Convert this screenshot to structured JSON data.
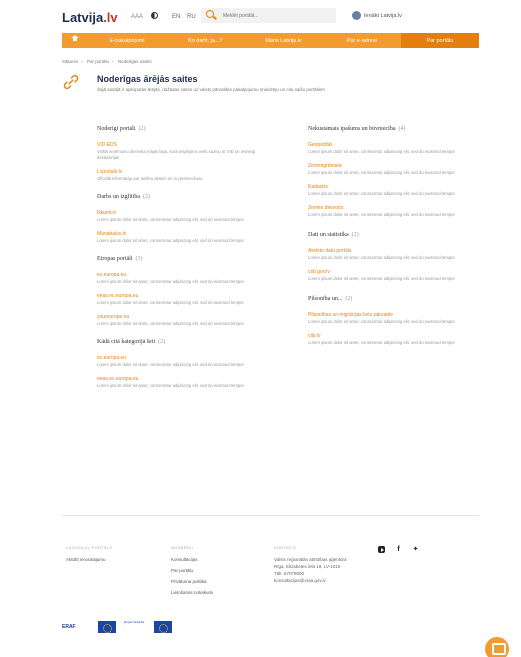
{
  "header": {
    "logo_text": "Latvija",
    "logo_accent": ".lv",
    "text_size_label": "AAA",
    "languages": [
      "EN",
      "RU"
    ],
    "search_placeholder": "Meklēt portālā...",
    "login_label": "Ienākt Latvija.lv"
  },
  "nav": {
    "items": [
      "E-pakalpojumi",
      "Ko darīt, ja...?",
      "Mans Latvija.lv",
      "Par e-adresi",
      "Par portālu"
    ],
    "active": "Par portālu"
  },
  "breadcrumb": [
    "Sākums",
    "Par portālu",
    "Noderīgas saites"
  ],
  "page": {
    "title": "Noderīgas ārējās saites",
    "description": "Šajā sadaļā ir apkopotas ārējās, dažādas saites uz valsts pārvaldes pakalpojumu sniedzēju un citu saišu portāliem",
    "icon": "link-icon"
  },
  "left_sections": [
    {
      "title": "Noderīgi portāli",
      "count": "(2)",
      "links": [
        {
          "title": "VID EDS",
          "desc": "Valsts ieņēmumu dienesta mājas lapa, kurā iespējams veikt saziņu ar VID un iesniegt deklarācijas"
        },
        {
          "title": "Lvportals.lv",
          "desc": "Oficiālā informācija par tiesību aktiem un to piemērošanu"
        }
      ]
    },
    {
      "title": "Darbs un izglītība",
      "count": "(2)",
      "links": [
        {
          "title": "Nkuml.lv",
          "desc": "Lorem ipsum dolor sit amet, consectetur adipiscing elit, sed do eiusmod tempor"
        },
        {
          "title": "Manabalss.lv",
          "desc": "Lorem ipsum dolor sit amet, consectetur adipiscing elit, sed do eiusmod tempor"
        }
      ]
    },
    {
      "title": "Eiropas portāli",
      "count": "(3)",
      "links": [
        {
          "title": "ec.europa.eu",
          "desc": "Lorem ipsum dolor sit amet, consectetur adipiscing elit, sed do eiusmod tempor"
        },
        {
          "title": "eeas.ec.europa.eu",
          "desc": "Lorem ipsum dolor sit amet, consectetur adipiscing elit, sed do eiusmod tempor"
        },
        {
          "title": "youreurope.eu",
          "desc": "Lorem ipsum dolor sit amet, consectetur adipiscing elit, sed do eiusmod tempor"
        }
      ]
    },
    {
      "title": "Kādā citā kategorijā šeit",
      "count": "(2)",
      "links": [
        {
          "title": "ec.europa.eu",
          "desc": "Lorem ipsum dolor sit amet, consectetur adipiscing elit, sed do eiusmod tempor"
        },
        {
          "title": "eeas.ec.europa.eu",
          "desc": "Lorem ipsum dolor sit amet, consectetur adipiscing elit, sed do eiusmod tempor"
        }
      ]
    }
  ],
  "right_sections": [
    {
      "title": "Nekustamais īpašums un būvniecība",
      "count": "(4)",
      "links": [
        {
          "title": "Geoportāls",
          "desc": "Lorem ipsum dolor sit amet, consectetur adipiscing elit, sed do eiusmod tempor"
        },
        {
          "title": "Zemesgrāmata",
          "desc": "Lorem ipsum dolor sit amet, consectetur adipiscing elit, sed do eiusmod tempor"
        },
        {
          "title": "Kadastrs",
          "desc": "Lorem ipsum dolor sit amet, consectetur adipiscing elit, sed do eiusmod tempor"
        },
        {
          "title": "Zemes dienests",
          "desc": "Lorem ipsum dolor sit amet, consectetur adipiscing elit, sed do eiusmod tempor"
        }
      ]
    },
    {
      "title": "Dati un statistika",
      "count": "(2)",
      "links": [
        {
          "title": "Atvērto datu portāls",
          "desc": "Lorem ipsum dolor sit amet, consectetur adipiscing elit, sed do eiusmod tempor"
        },
        {
          "title": "csb.gov.lv",
          "desc": "Lorem ipsum dolor sit amet, consectetur adipiscing elit, sed do eiusmod tempor"
        }
      ]
    },
    {
      "title": "Pilsonība un...",
      "count": "(2)",
      "links": [
        {
          "title": "Pilsonības un migrācijas lietu pārvalde",
          "desc": "Lorem ipsum dolor sit amet, consectetur adipiscing elit, sed do eiusmod tempor"
        },
        {
          "title": "cilp.lv",
          "desc": "Lorem ipsum dolor sit amet, consectetur adipiscing elit, sed do eiusmod tempor"
        }
      ]
    }
  ],
  "footer": {
    "col1": {
      "heading": "Latvija.lv portāls",
      "items": [
        "Atsūtīt ierosinājumu"
      ]
    },
    "col2": {
      "heading": "Noderīgi",
      "items": [
        "Konsultācijas",
        "Par portālu",
        "Privātuma politika",
        "Lietošanas noteikumi"
      ]
    },
    "col3": {
      "heading": "Kontakti",
      "items": [
        "Valsts reģionālās attīstības aģentūra",
        "Rīga, Elizabetes iela 19, LV-1010",
        "Tālr. 67079000",
        "konsultacijas@vraa.gov.lv"
      ]
    },
    "social": [
      "youtube-icon",
      "facebook-icon",
      "twitter-icon"
    ]
  },
  "logos": {
    "erdf": "ERAF",
    "eu_text": "Eiropas Savienība"
  }
}
